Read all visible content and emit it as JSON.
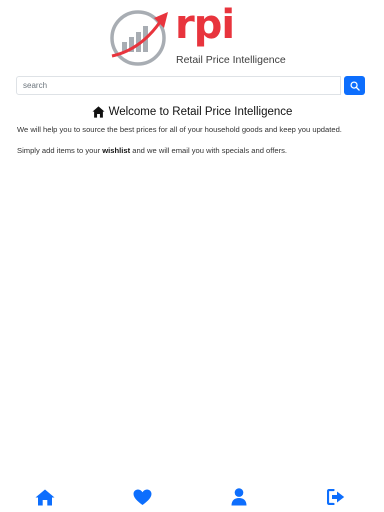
{
  "brand": {
    "wordmark": "rpi",
    "tagline": "Retail Price Intelligence",
    "colors": {
      "red": "#e8343d",
      "grey": "#a8adb3",
      "blue": "#0d6efd"
    }
  },
  "search": {
    "placeholder": "search",
    "button_icon": "search-icon"
  },
  "welcome": {
    "icon": "home-icon",
    "title": "Welcome to Retail Price Intelligence"
  },
  "content": {
    "intro": "We will help you to source the best prices for all of your household goods and keep you updated.",
    "wishlist_prefix": "Simply add items to your ",
    "wishlist_word": "wishlist",
    "wishlist_suffix": " and we will email you with specials and offers."
  },
  "bottom_nav": [
    {
      "icon": "home-icon"
    },
    {
      "icon": "heart-icon"
    },
    {
      "icon": "user-icon"
    },
    {
      "icon": "logout-icon"
    }
  ]
}
